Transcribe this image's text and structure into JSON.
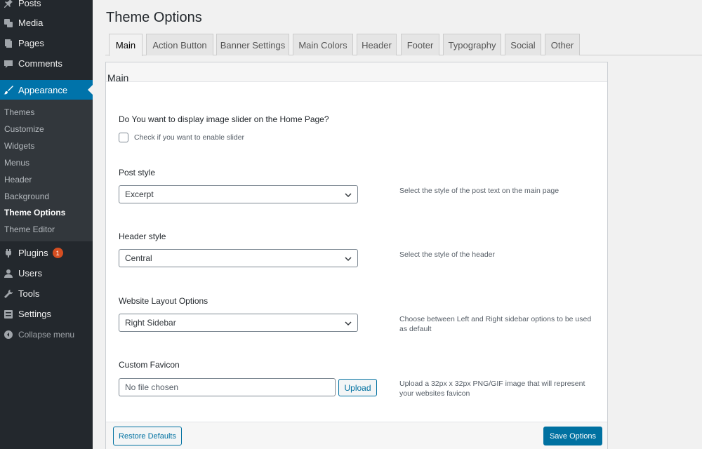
{
  "sidebar": {
    "items": [
      {
        "label": "Posts",
        "icon": "pin-icon"
      },
      {
        "label": "Media",
        "icon": "media-icon"
      },
      {
        "label": "Pages",
        "icon": "pages-icon"
      },
      {
        "label": "Comments",
        "icon": "comments-icon"
      },
      {
        "label": "Appearance",
        "icon": "brush-icon"
      },
      {
        "label": "Plugins",
        "icon": "plugin-icon",
        "badge": "1"
      },
      {
        "label": "Users",
        "icon": "users-icon"
      },
      {
        "label": "Tools",
        "icon": "wrench-icon"
      },
      {
        "label": "Settings",
        "icon": "settings-icon"
      },
      {
        "label": "Collapse menu",
        "icon": "collapse-icon"
      }
    ],
    "submenu": [
      "Themes",
      "Customize",
      "Widgets",
      "Menus",
      "Header",
      "Background",
      "Theme Options",
      "Theme Editor"
    ],
    "active_submenu": "Theme Options",
    "colors": {
      "bg": "#23282d",
      "submenu_bg": "#32373c",
      "active": "#0073aa",
      "badge": "#d54e21"
    }
  },
  "page": {
    "title": "Theme Options",
    "tabs": [
      "Main",
      "Action Button",
      "Banner Settings",
      "Main Colors",
      "Header",
      "Footer",
      "Typography",
      "Social",
      "Other"
    ],
    "active_tab": "Main"
  },
  "panel": {
    "title": "Main",
    "slider": {
      "question": "Do You want to display image slider on the Home Page?",
      "checkbox_label": "Check if you want to enable slider",
      "checked": false
    },
    "post_style": {
      "label": "Post style",
      "value": "Excerpt",
      "hint": "Select the style of the post text on the main page"
    },
    "header_style": {
      "label": "Header style",
      "value": "Central",
      "hint": "Select the style of the header"
    },
    "layout": {
      "label": "Website Layout Options",
      "value": "Right Sidebar",
      "hint": "Choose between Left and Right sidebar options to be used as default"
    },
    "favicon": {
      "label": "Custom Favicon",
      "placeholder": "No file chosen",
      "upload_label": "Upload",
      "hint": "Upload a 32px x 32px PNG/GIF image that will represent your websites favicon"
    },
    "restore_label": "Restore Defaults",
    "save_label": "Save Options"
  }
}
